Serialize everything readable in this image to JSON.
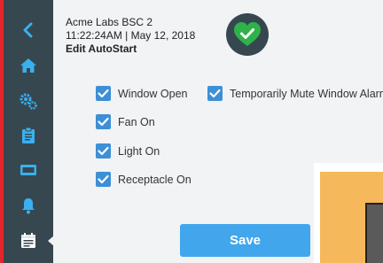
{
  "header": {
    "device_name": "Acme Labs BSC 2",
    "timestamp": "11:22:24AM | May 12, 2018",
    "page_title": "Edit AutoStart"
  },
  "status": {
    "icon": "heart-check-icon",
    "color": "#2eb34a"
  },
  "sidebar": {
    "items": [
      {
        "icon": "chevron-left-icon"
      },
      {
        "icon": "home-icon"
      },
      {
        "icon": "settings-gears-icon"
      },
      {
        "icon": "clipboard-icon"
      },
      {
        "icon": "display-icon"
      },
      {
        "icon": "bell-icon"
      },
      {
        "icon": "calendar-icon"
      }
    ]
  },
  "options": [
    {
      "label": "Window Open",
      "checked": true
    },
    {
      "label": "Temporarily Mute Window Alarm",
      "checked": true
    },
    {
      "label": "Fan On",
      "checked": true
    },
    {
      "label": "Light On",
      "checked": true
    },
    {
      "label": "Receptacle On",
      "checked": true
    }
  ],
  "actions": {
    "save_label": "Save"
  },
  "colors": {
    "accent": "#3d8fd6",
    "sidebar": "#37474f",
    "button": "#42a6ec",
    "frame": "#e3262b"
  }
}
